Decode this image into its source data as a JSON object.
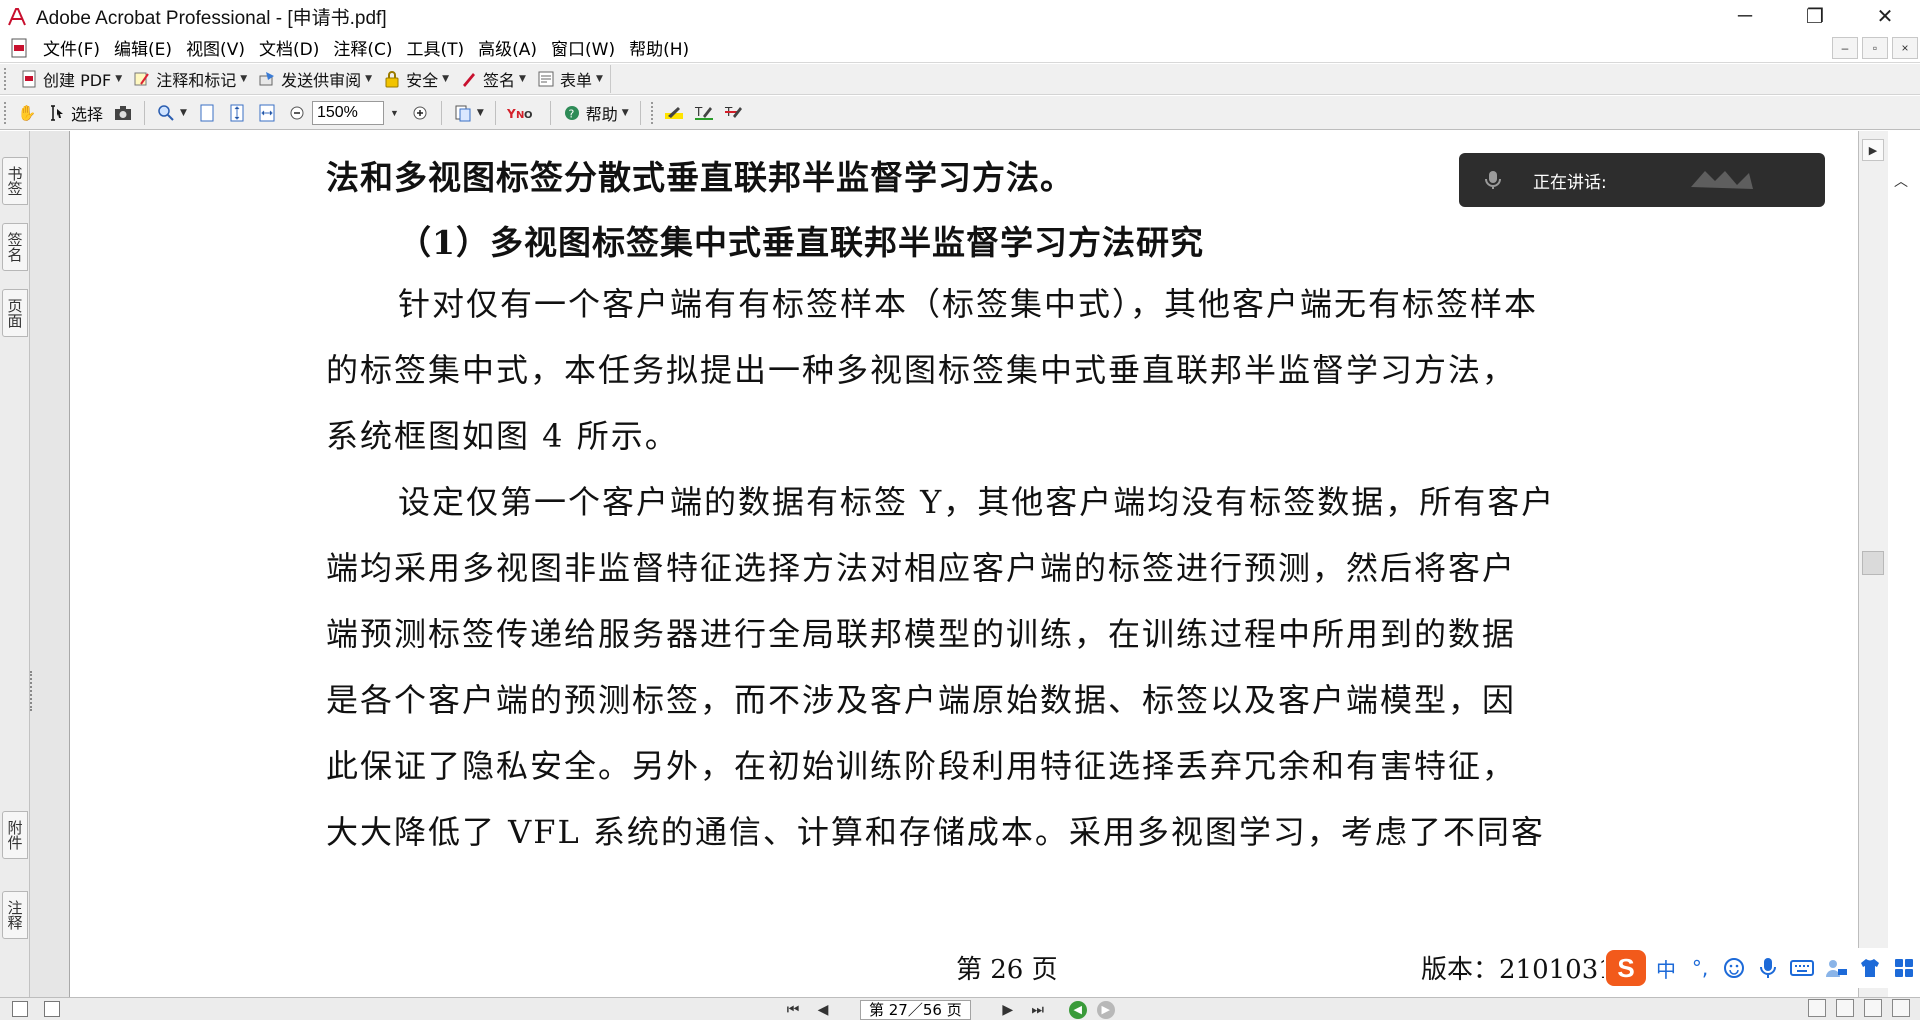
{
  "window": {
    "title": "Adobe Acrobat Professional - [申请书.pdf]",
    "controls": {
      "minimize": "─",
      "restore": "❐",
      "close": "✕"
    }
  },
  "menubar": {
    "items": [
      "文件(F)",
      "编辑(E)",
      "视图(V)",
      "文档(D)",
      "注释(C)",
      "工具(T)",
      "高级(A)",
      "窗口(W)",
      "帮助(H)"
    ],
    "mdi": {
      "minimize": "–",
      "restore": "▫",
      "close": "×"
    }
  },
  "toolbar1": {
    "create_pdf": "创建 PDF",
    "comment_markup": "注释和标记",
    "send_review": "发送供审阅",
    "security": "安全",
    "sign": "签名",
    "forms": "表单"
  },
  "toolbar2": {
    "select": "选择",
    "zoom_value": "150%",
    "help": "帮助"
  },
  "side_tabs": {
    "bookmarks": "书签",
    "signatures": "签名",
    "pages": "页面",
    "attachments": "附件",
    "comments": "注释"
  },
  "document": {
    "heading_continued": "法和多视图标签分散式垂直联邦半监督学习方法。",
    "subheading": "（1）多视图标签集中式垂直联邦半监督学习方法研究",
    "lines": [
      "针对仅有一个客户端有有标签样本（标签集中式），其他客户端无有标签样本",
      "的标签集中式，本任务拟提出一种多视图标签集中式垂直联邦半监督学习方法，",
      "系统框图如图 4 所示。",
      "设定仅第一个客户端的数据有标签 Y，其他客户端均没有标签数据，所有客户",
      "端均采用多视图非监督特征选择方法对相应客户端的标签进行预测，然后将客户",
      "端预测标签传递给服务器进行全局联邦模型的训练，在训练过程中所用到的数据",
      "是各个客户端的预测标签，而不涉及客户端原始数据、标签以及客户端模型，因",
      "此保证了隐私安全。另外，在初始训练阶段利用特征选择丢弃冗余和有害特征，",
      "大大降低了 VFL 系统的通信、计算和存储成本。采用多视图学习，考虑了不同客"
    ],
    "footer_page": "第 26 页",
    "footer_version": "版本：210103191329"
  },
  "speaking_overlay": {
    "label": "正在讲话:"
  },
  "ime": {
    "logo": "S",
    "mode": "中",
    "punct": "°,"
  },
  "statusbar": {
    "page_indicator": "第 27／56 页"
  },
  "colors": {
    "toolbar_bg": "#f0f0f0",
    "overlay_bg": "#2d2d2d",
    "ime_brand": "#f25a1b",
    "ime_icon": "#1d6ad8"
  }
}
